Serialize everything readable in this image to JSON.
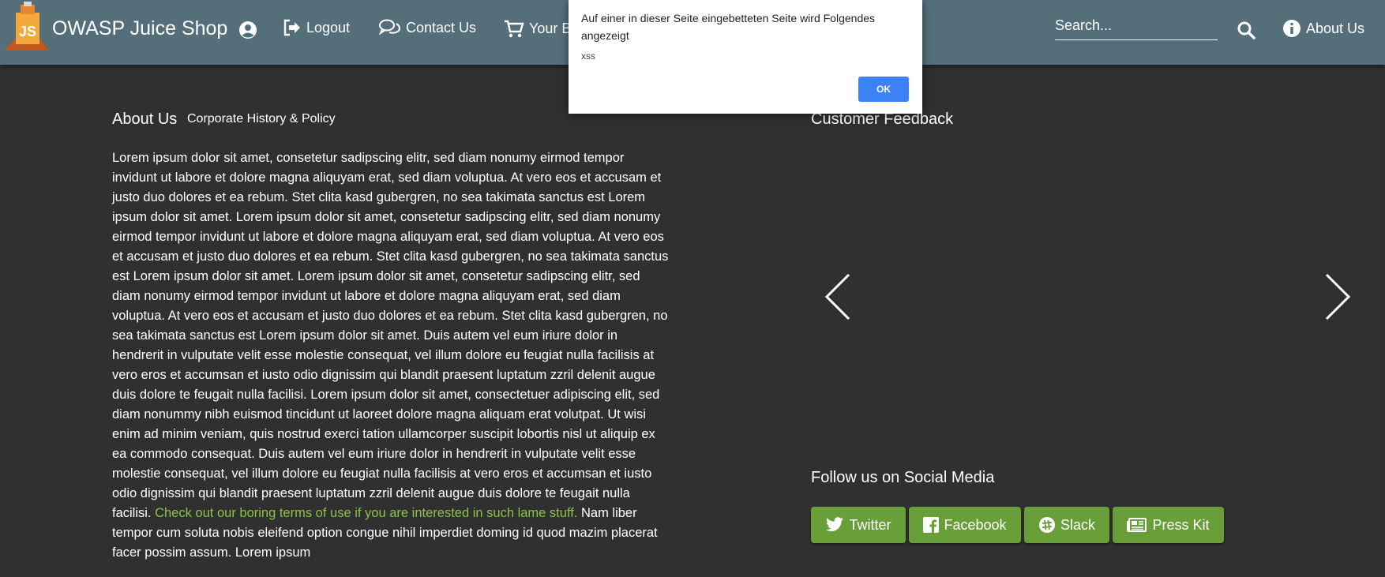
{
  "header": {
    "app_title": "OWASP Juice Shop",
    "logout_label": "Logout",
    "contact_label": "Contact Us",
    "basket_label": "Your Basket",
    "search_placeholder": "Search...",
    "about_label": "About Us"
  },
  "dialog": {
    "title": "Auf einer in dieser Seite eingebetteten Seite wird Folgendes angezeigt",
    "message": "xss",
    "ok_label": "OK"
  },
  "about": {
    "heading": "About Us",
    "subheading": "Corporate History & Policy",
    "text_before_link": "Lorem ipsum dolor sit amet, consetetur sadipscing elitr, sed diam nonumy eirmod tempor invidunt ut labore et dolore magna aliquyam erat, sed diam voluptua. At vero eos et accusam et justo duo dolores et ea rebum. Stet clita kasd gubergren, no sea takimata sanctus est Lorem ipsum dolor sit amet. Lorem ipsum dolor sit amet, consetetur sadipscing elitr, sed diam nonumy eirmod tempor invidunt ut labore et dolore magna aliquyam erat, sed diam voluptua. At vero eos et accusam et justo duo dolores et ea rebum. Stet clita kasd gubergren, no sea takimata sanctus est Lorem ipsum dolor sit amet. Lorem ipsum dolor sit amet, consetetur sadipscing elitr, sed diam nonumy eirmod tempor invidunt ut labore et dolore magna aliquyam erat, sed diam voluptua. At vero eos et accusam et justo duo dolores et ea rebum. Stet clita kasd gubergren, no sea takimata sanctus est Lorem ipsum dolor sit amet. Duis autem vel eum iriure dolor in hendrerit in vulputate velit esse molestie consequat, vel illum dolore eu feugiat nulla facilisis at vero eros et accumsan et iusto odio dignissim qui blandit praesent luptatum zzril delenit augue duis dolore te feugait nulla facilisi. Lorem ipsum dolor sit amet, consectetuer adipiscing elit, sed diam nonummy nibh euismod tincidunt ut laoreet dolore magna aliquam erat volutpat. Ut wisi enim ad minim veniam, quis nostrud exerci tation ullamcorper suscipit lobortis nisl ut aliquip ex ea commodo consequat. Duis autem vel eum iriure dolor in hendrerit in vulputate velit esse molestie consequat, vel illum dolore eu feugiat nulla facilisis at vero eros et accumsan et iusto odio dignissim qui blandit praesent luptatum zzril delenit augue duis dolore te feugait nulla facilisi. ",
    "link_text": "Check out our boring terms of use if you are interested in such lame stuff.",
    "text_after_link": " Nam liber tempor cum soluta nobis eleifend option congue nihil imperdiet doming id quod mazim placerat facer possim assum. Lorem ipsum"
  },
  "feedback": {
    "heading": "Customer Feedback"
  },
  "social": {
    "heading": "Follow us on Social Media",
    "buttons": [
      {
        "label": "Twitter",
        "icon": "twitter-icon"
      },
      {
        "label": "Facebook",
        "icon": "facebook-icon"
      },
      {
        "label": "Slack",
        "icon": "slack-icon"
      },
      {
        "label": "Press Kit",
        "icon": "newspaper-icon"
      }
    ]
  },
  "colors": {
    "toolbar": "#546e7a",
    "background": "#303030",
    "link": "#8bc34a",
    "social_button": "#689f38",
    "dialog_button": "#3b82f6"
  }
}
